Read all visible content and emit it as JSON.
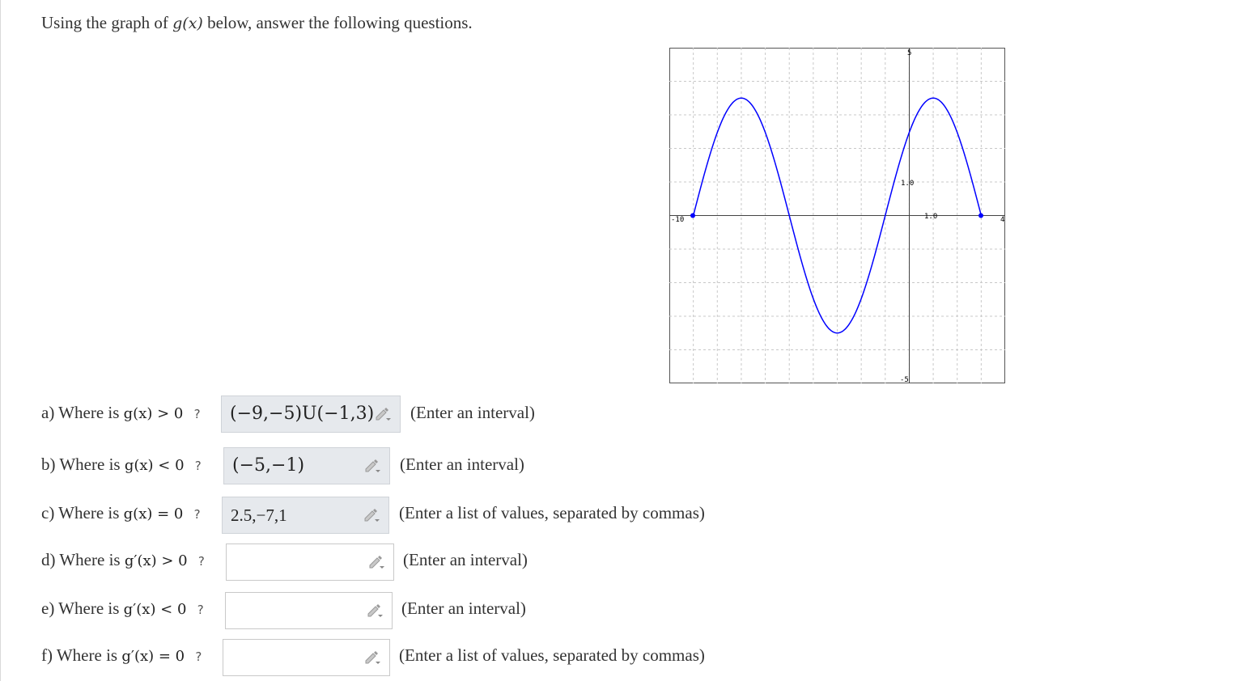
{
  "intro": {
    "prefix": "Using the graph of",
    "func": "g(x)",
    "suffix": "below, answer the following questions."
  },
  "graph": {
    "x_min_label": "-10",
    "x_max_label": "4",
    "y_max_label": "5",
    "y_min_label": "-5",
    "y_unit_label": "1.0",
    "x_unit_label": "1.0",
    "curve_color": "#0000ff"
  },
  "questions": [
    {
      "letter": "a) Where is",
      "expr": "g(x) > 0",
      "mark": "?",
      "value": "(−9,−5)U(−1,3)",
      "hint": "(Enter an interval)"
    },
    {
      "letter": "b) Where is",
      "expr": "g(x) < 0",
      "mark": "?",
      "value": "(−5,−1)",
      "hint": "(Enter an interval)"
    },
    {
      "letter": "c) Where is",
      "expr": "g(x) = 0",
      "mark": "?",
      "value": "2.5,−7,1",
      "hint": "(Enter a list of values, separated by commas)"
    },
    {
      "letter": "d) Where is",
      "expr": "g′(x) > 0",
      "mark": "?",
      "value": "",
      "hint": "(Enter an interval)"
    },
    {
      "letter": "e) Where is",
      "expr": "g′(x) < 0",
      "mark": "?",
      "value": "",
      "hint": "(Enter an interval)"
    },
    {
      "letter": "f) Where is",
      "expr": "g′(x) = 0",
      "mark": "?",
      "value": "",
      "hint": "(Enter a list of values, separated by commas)"
    }
  ]
}
